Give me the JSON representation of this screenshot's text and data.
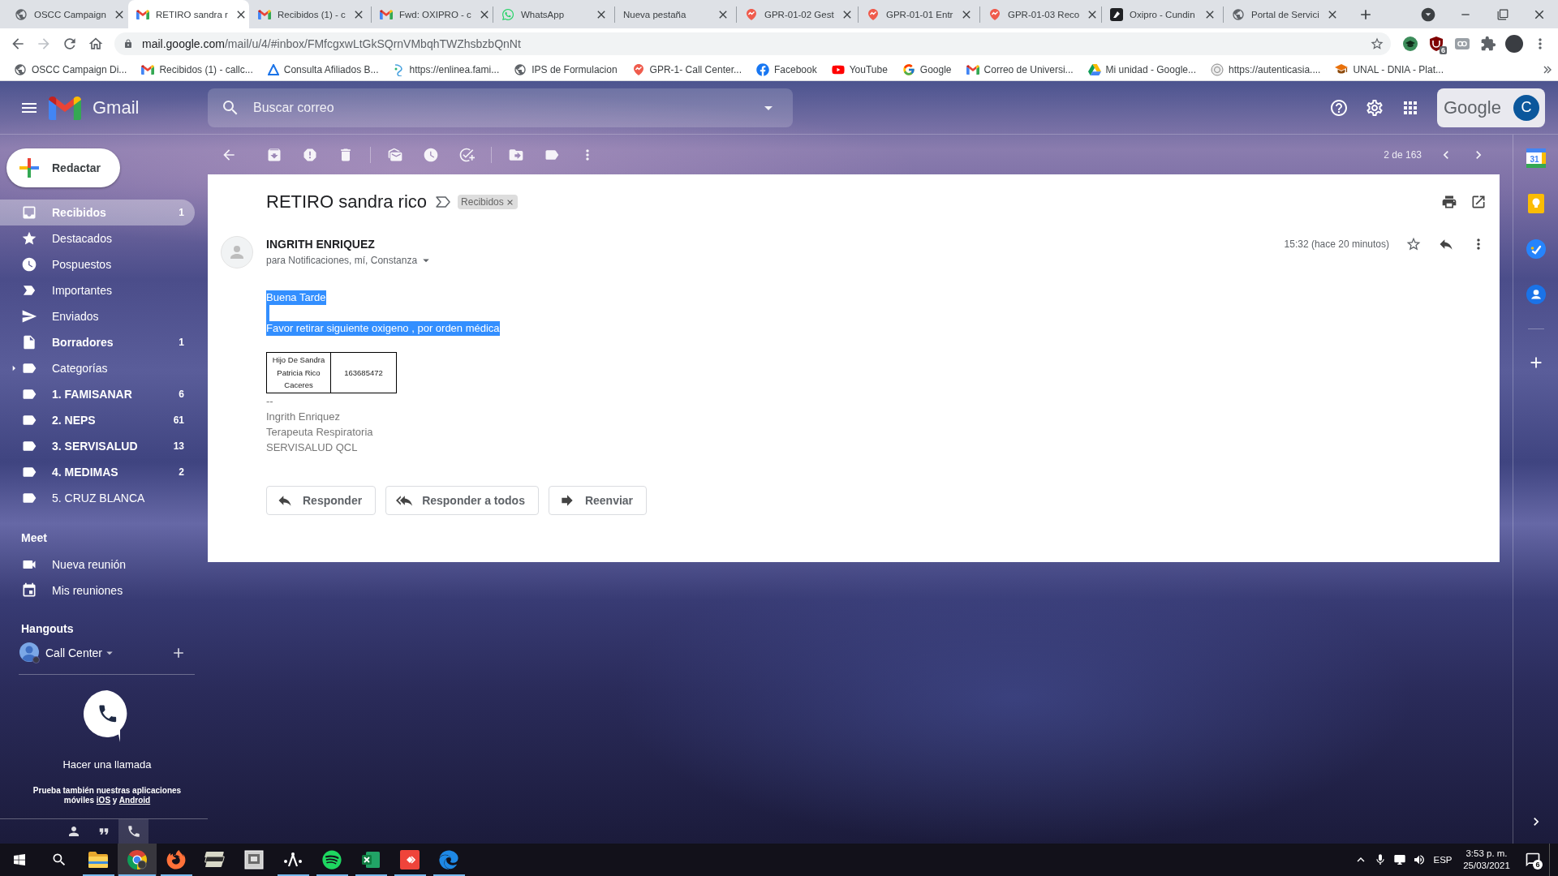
{
  "browser": {
    "tabs": [
      {
        "title": "OSCC Campaign",
        "kind": "globe",
        "selected": false
      },
      {
        "title": "RETIRO sandra r",
        "kind": "mail",
        "selected": true
      },
      {
        "title": "Recibidos (1) - c",
        "kind": "mail",
        "selected": false
      },
      {
        "title": "Fwd: OXIPRO - c",
        "kind": "mail",
        "selected": false
      },
      {
        "title": "WhatsApp",
        "kind": "chat",
        "selected": false
      },
      {
        "title": "Nueva pestaña",
        "kind": "blank",
        "selected": false
      },
      {
        "title": "GPR-01-02 Gest",
        "kind": "pin",
        "selected": false
      },
      {
        "title": "GPR-01-01 Entr",
        "kind": "pin",
        "selected": false
      },
      {
        "title": "GPR-01-03 Reco",
        "kind": "pin",
        "selected": false
      },
      {
        "title": "Oxipro - Cundin",
        "kind": "dark",
        "selected": false
      },
      {
        "title": "Portal de Servici",
        "kind": "globe",
        "selected": false
      }
    ],
    "forward_disabled": true,
    "address": {
      "host": "mail.google.com",
      "path": "/mail/u/4/#inbox/FMfcgxwLtGkSQrnVMbqhTWZhsbzbQnNt"
    },
    "extension_badge": "6",
    "bookmarks": [
      {
        "label": "OSCC Campaign Di...",
        "kind": "globe"
      },
      {
        "label": "Recibidos (1) - callc...",
        "kind": "mail"
      },
      {
        "label": "Consulta Afiliados B...",
        "kind": "triangle"
      },
      {
        "label": "https://enlinea.fami...",
        "kind": "swirl"
      },
      {
        "label": "IPS de Formulacion",
        "kind": "globe"
      },
      {
        "label": "GPR-1- Call Center...",
        "kind": "pin"
      },
      {
        "label": "Facebook",
        "kind": "facebook"
      },
      {
        "label": "YouTube",
        "kind": "youtube"
      },
      {
        "label": "Google",
        "kind": "google"
      },
      {
        "label": "Correo de Universi...",
        "kind": "mail"
      },
      {
        "label": "Mi unidad - Google...",
        "kind": "drive"
      },
      {
        "label": "https://autenticasia....",
        "kind": "seal"
      },
      {
        "label": "UNAL - DNIA - Plat...",
        "kind": "cap"
      }
    ]
  },
  "gmail": {
    "app_name": "Gmail",
    "search": {
      "placeholder": "Buscar correo"
    },
    "account": {
      "wordmark": "Google",
      "initial": "C"
    },
    "compose": "Redactar",
    "folders": [
      {
        "label": "Recibidos",
        "count": "1",
        "kind": "inbox",
        "selected": true,
        "unread": true
      },
      {
        "label": "Destacados",
        "kind": "starred",
        "selected": false,
        "unread": false
      },
      {
        "label": "Pospuestos",
        "kind": "snoozed",
        "selected": false,
        "unread": false
      },
      {
        "label": "Importantes",
        "kind": "important",
        "selected": false,
        "unread": false
      },
      {
        "label": "Enviados",
        "kind": "sent",
        "selected": false,
        "unread": false
      },
      {
        "label": "Borradores",
        "count": "1",
        "kind": "drafts",
        "selected": false,
        "unread": true
      },
      {
        "label": "Categorías",
        "kind": "group",
        "expanded": false,
        "selected": false,
        "unread": false
      },
      {
        "label": "1. FAMISANAR",
        "count": "6",
        "kind": "label",
        "selected": false,
        "unread": true
      },
      {
        "label": "2. NEPS",
        "count": "61",
        "kind": "label",
        "selected": false,
        "unread": true
      },
      {
        "label": "3. SERVISALUD",
        "count": "13",
        "kind": "label",
        "selected": false,
        "unread": true
      },
      {
        "label": "4. MEDIMAS",
        "count": "2",
        "kind": "label",
        "selected": false,
        "unread": true
      },
      {
        "label": "5. CRUZ BLANCA",
        "kind": "label",
        "selected": false,
        "unread": false
      }
    ],
    "meet": {
      "heading": "Meet",
      "items": [
        {
          "label": "Nueva reunión",
          "kind": "video"
        },
        {
          "label": "Mis reuniones",
          "kind": "calendar"
        }
      ]
    },
    "hangouts": {
      "heading": "Hangouts",
      "user": "Call Center",
      "call_prompt": "Hacer una llamada",
      "apps_note": "Prueba también nuestras aplicaciones móviles",
      "app_links": [
        "iOS",
        "Android"
      ],
      "link_joiner": "y",
      "tabs": [
        {
          "kind": "contacts",
          "selected": false
        },
        {
          "kind": "chat",
          "selected": false
        },
        {
          "kind": "phone",
          "selected": true
        }
      ]
    },
    "pager": "2 de 163",
    "message": {
      "subject": "RETIRO sandra rico",
      "label": "Recibidos",
      "sender": "INGRITH ENRIQUEZ",
      "recipients": "para Notificaciones, mí, Constanza",
      "time": "15:32 (hace 20 minutos)",
      "starred": false,
      "body": {
        "selected": true,
        "lines": [
          "Buena Tarde",
          "Favor retirar siguiente oxigeno , por orden médica"
        ]
      },
      "table": {
        "rows": [
          [
            "Hijo De Sandra Patricia Rico Caceres",
            "163685472"
          ]
        ]
      },
      "signature": {
        "separator": "--",
        "lines": [
          "Ingrith Enriquez",
          "Terapeuta Respiratoria",
          "SERVISALUD QCL"
        ]
      },
      "actions": [
        {
          "label": "Responder",
          "kind": "reply"
        },
        {
          "label": "Responder a todos",
          "kind": "reply_all"
        },
        {
          "label": "Reenviar",
          "kind": "forward"
        }
      ]
    },
    "side_apps": [
      {
        "kind": "calendar",
        "day": "31"
      },
      {
        "kind": "keep"
      },
      {
        "kind": "tasks"
      },
      {
        "kind": "contacts"
      }
    ]
  },
  "taskbar": {
    "apps": [
      {
        "kind": "explorer",
        "running": true,
        "selected": false
      },
      {
        "kind": "chrome",
        "running": true,
        "selected": true
      },
      {
        "kind": "firefox",
        "running": true,
        "selected": false
      },
      {
        "kind": "cards",
        "running": false,
        "selected": false
      },
      {
        "kind": "viewer",
        "running": false,
        "selected": false
      },
      {
        "kind": "figure",
        "running": true,
        "selected": false
      },
      {
        "kind": "spotify",
        "running": true,
        "selected": false
      },
      {
        "kind": "excel",
        "running": true,
        "selected": false
      },
      {
        "kind": "remote",
        "running": true,
        "selected": false
      },
      {
        "kind": "edge",
        "running": true,
        "selected": false
      }
    ],
    "language": "ESP",
    "time": "3:53 p. m.",
    "date": "25/03/2021",
    "notification_count": "6"
  }
}
